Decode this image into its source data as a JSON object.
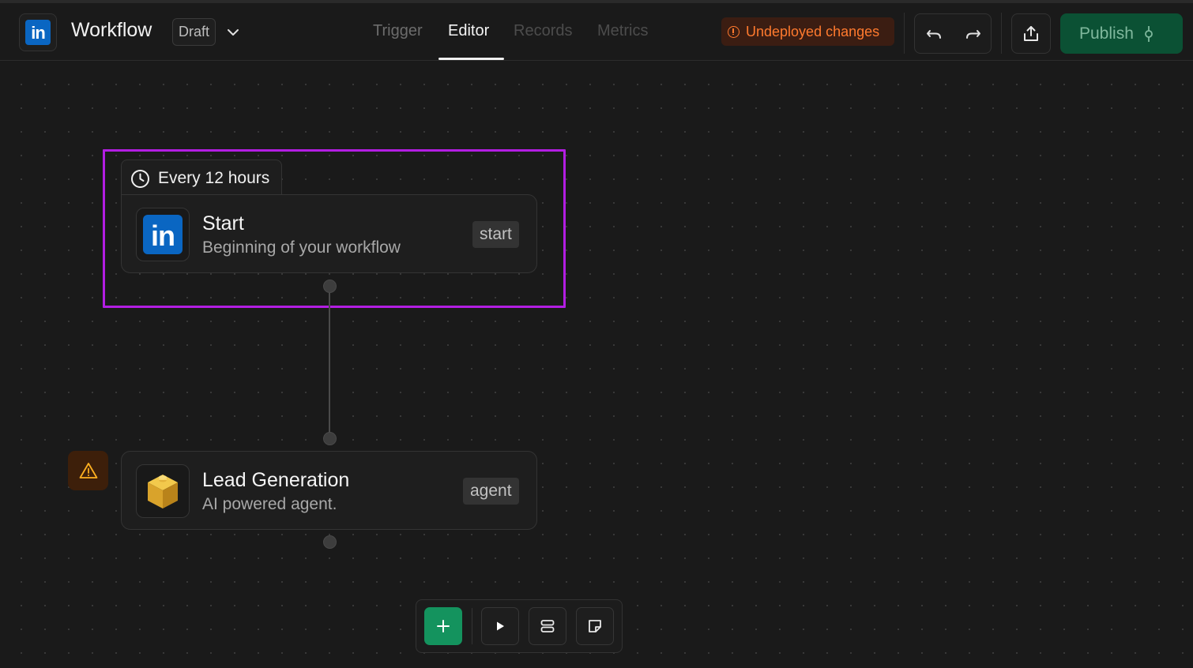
{
  "header": {
    "app_title": "Workflow",
    "status_badge": "Draft",
    "tabs": [
      {
        "label": "Trigger",
        "active": false
      },
      {
        "label": "Editor",
        "active": true
      },
      {
        "label": "Records",
        "active": false
      },
      {
        "label": "Metrics",
        "active": false
      }
    ],
    "undeployed_label": "Undeployed changes",
    "publish_label": "Publish",
    "logo_text": "in"
  },
  "canvas": {
    "trigger": {
      "schedule_label": "Every 12 hours"
    },
    "nodes": [
      {
        "title": "Start",
        "subtitle": "Beginning of your workflow",
        "tag": "start",
        "icon": "linkedin-icon",
        "icon_text": "in"
      },
      {
        "title": "Lead Generation",
        "subtitle": "AI powered agent.",
        "tag": "agent",
        "icon": "cube-icon"
      }
    ]
  },
  "toolbar": {
    "items": [
      "add-icon",
      "play-icon",
      "layout-icon",
      "note-icon"
    ]
  },
  "colors": {
    "background": "#1a1a1a",
    "selection": "#b31ee3",
    "publish": "#0b5134",
    "warning_text": "#ff7a2e",
    "add_button": "#14935e",
    "linkedin_blue": "#0a66c2"
  }
}
